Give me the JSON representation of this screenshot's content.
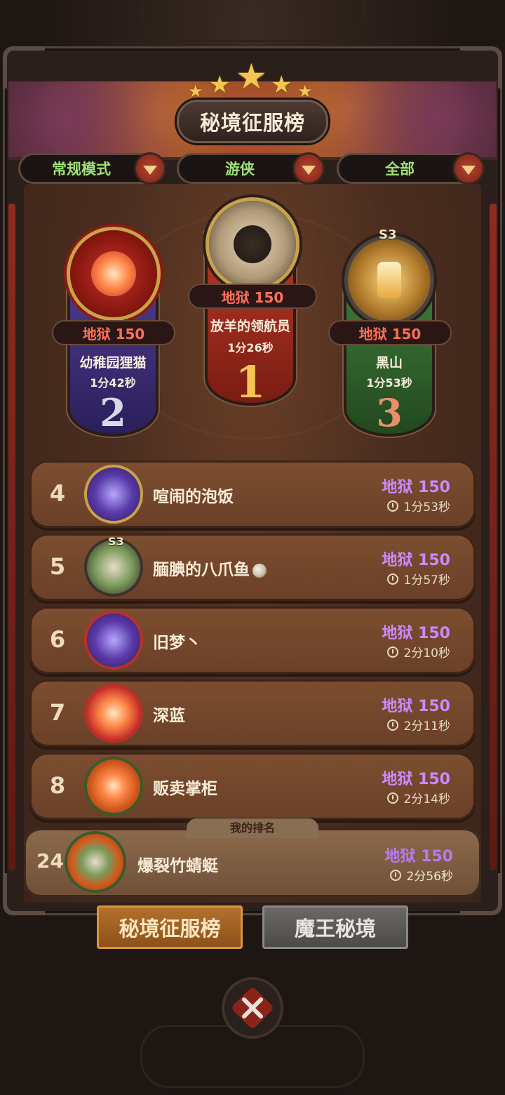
{
  "header": {
    "title": "秘境征服榜"
  },
  "filters": [
    {
      "label": "常规模式"
    },
    {
      "label": "游侠"
    },
    {
      "label": "全部"
    }
  ],
  "podium": {
    "first": {
      "rank": "1",
      "difficulty": "地狱 150",
      "name": "放羊的领航员",
      "time": "1分26秒"
    },
    "second": {
      "rank": "2",
      "difficulty": "地狱 150",
      "name": "幼稚园狸猫",
      "time": "1分42秒"
    },
    "third": {
      "rank": "3",
      "difficulty": "地狱 150",
      "name": "黑山",
      "time": "1分53秒",
      "season_tag": "S3"
    }
  },
  "list": [
    {
      "rank": "4",
      "name": "喧闹的泡饭",
      "difficulty": "地狱 150",
      "time": "1分53秒"
    },
    {
      "rank": "5",
      "name": "腼腆的八爪鱼",
      "difficulty": "地狱 150",
      "time": "1分57秒",
      "season_tag": "S3"
    },
    {
      "rank": "6",
      "name": "旧梦丶",
      "difficulty": "地狱 150",
      "time": "2分10秒"
    },
    {
      "rank": "7",
      "name": "深蓝",
      "difficulty": "地狱 150",
      "time": "2分11秒"
    },
    {
      "rank": "8",
      "name": "贩卖掌柜",
      "difficulty": "地狱 150",
      "time": "2分14秒"
    }
  ],
  "my_rank": {
    "label": "我的排名",
    "rank": "24",
    "name": "爆裂竹蜻蜓",
    "difficulty": "地狱 150",
    "time": "2分56秒"
  },
  "tabs": [
    {
      "label": "秘境征服榜",
      "active": true
    },
    {
      "label": "魔王秘境",
      "active": false
    }
  ],
  "colors": {
    "accent_green": "#9fe37a",
    "difficulty_red": "#ff6f5a",
    "difficulty_purple": "#c98aff",
    "tab_active": "#b4722c"
  },
  "icons": [
    "star-icon",
    "dropdown-arrow-icon",
    "clock-icon",
    "close-icon"
  ]
}
